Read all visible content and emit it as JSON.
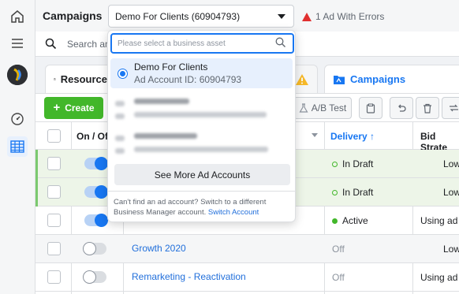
{
  "header": {
    "title": "Campaigns",
    "account_selector": "Demo For Clients (60904793)",
    "errors_text": "1 Ad With Errors"
  },
  "search": {
    "placeholder": "Search an"
  },
  "tabs": [
    {
      "label": "Resource"
    },
    {
      "label": ""
    },
    {
      "label": "Campaigns"
    }
  ],
  "toolbar": {
    "create_label": "Create",
    "ab_test_label": "A/B Test"
  },
  "table": {
    "columns": {
      "onoff": "On / Off",
      "delivery": "Delivery ↑",
      "bid": "Bid Strate"
    },
    "rows": [
      {
        "name": "",
        "on": true,
        "delivery": "In Draft",
        "delivery_state": "draft",
        "bid": "Low",
        "highlight": true
      },
      {
        "name": "",
        "on": true,
        "delivery": "In Draft",
        "delivery_state": "draft",
        "bid": "Low",
        "highlight": true
      },
      {
        "name": "",
        "on": true,
        "delivery": "Active",
        "delivery_state": "active",
        "bid": "Using ad s",
        "highlight": false
      },
      {
        "name": "Growth 2020",
        "on": false,
        "delivery": "Off",
        "delivery_state": "off",
        "bid": "Low",
        "highlight": false
      },
      {
        "name": "Remarketing - Reactivation",
        "on": false,
        "delivery": "Off",
        "delivery_state": "off",
        "bid": "Using ad s",
        "highlight": false
      }
    ]
  },
  "dropdown": {
    "search_placeholder": "Please select a business asset",
    "selected": {
      "name": "Demo For Clients",
      "id_text": "Ad Account ID: 60904793"
    },
    "see_more": "See More Ad Accounts",
    "footer_text": "Can't find an ad account? Switch to a different Business Manager account.",
    "footer_link": "Switch Account"
  },
  "colors": {
    "accent": "#1877f2",
    "create_green": "#42b72a",
    "error_red": "#e02f2f",
    "warning_yellow": "#f7b928"
  }
}
